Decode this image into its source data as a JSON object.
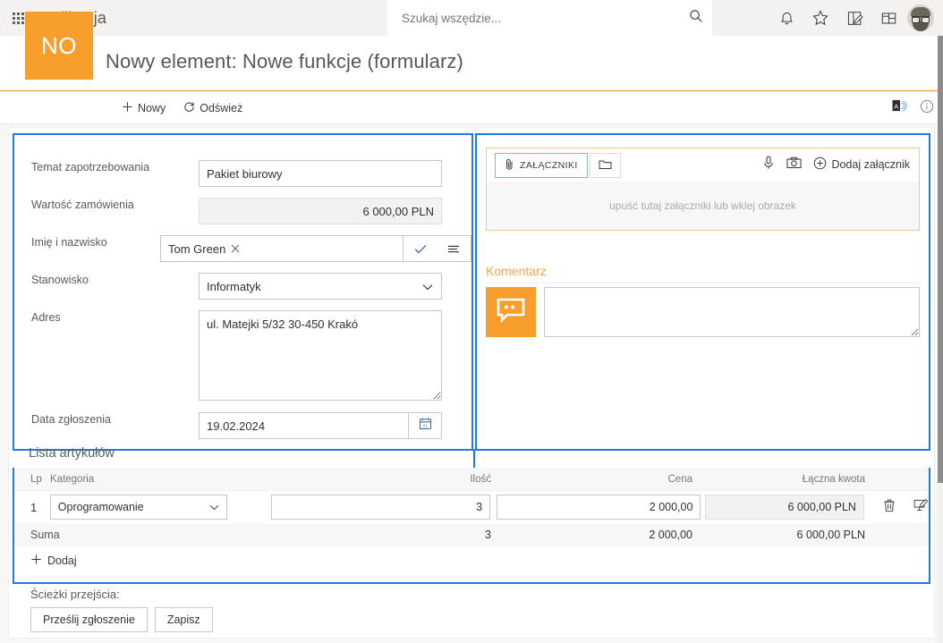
{
  "suitebar": {
    "waffle_label": "app-launcher",
    "app_name": "Aplikacja",
    "search_placeholder": "Szukaj wszędzie...",
    "icons": [
      "bell-icon",
      "star-icon",
      "notebook-edit-icon",
      "board-icon",
      "avatar"
    ]
  },
  "header": {
    "logo_initials": "NO",
    "title": "Nowy element: Nowe funkcje (formularz)",
    "accent_color": "#f79e2c"
  },
  "commandbar": {
    "new_label": "Nowy",
    "refresh_label": "Odśwież",
    "right_icons": [
      "immersive-reader-icon",
      "info-icon"
    ]
  },
  "form": {
    "frame_color": "#1e7ce0",
    "fields": [
      {
        "label": "Temat zapotrzebowania",
        "value": "Pakiet biurowy"
      },
      {
        "label": "Wartość zamówienia",
        "value": "6 000,00 PLN"
      },
      {
        "label": "Imię i nazwisko",
        "value": "Tom Green"
      },
      {
        "label": "Stanowisko",
        "value": "Informatyk"
      },
      {
        "label": "Adres",
        "value": "ul. Matejki 5/32 30-450 Krakó"
      },
      {
        "label": "Data zgłoszenia",
        "value": "19.02.2024"
      }
    ]
  },
  "attachments": {
    "tab_label": "ZAŁĄCZNIKI",
    "folder_icon": "folder-icon",
    "mic_icon": "microphone-icon",
    "camera_icon": "camera-icon",
    "add_label": "Dodaj załącznik",
    "dropzone_text": "upuść tutaj załączniki lub wklej obrazek",
    "border_color": "#f3c98a"
  },
  "comment": {
    "title": "Komentarz",
    "title_color": "#f6a44a",
    "avatar_icon": "comment-bubble-icon",
    "value": "",
    "placeholder": ""
  },
  "article_list": {
    "title": "Lista artykułów",
    "columns": [
      "Lp",
      "Kategoria",
      "Ilość",
      "Cena",
      "Łączna kwota"
    ],
    "rows": [
      {
        "lp": "1",
        "kategoria": "Oprogramowanie",
        "ilosc": "3",
        "cena": "2 000,00",
        "kwota": "6 000,00 PLN",
        "delete_icon": "trash-icon",
        "edit_icon": "edit-screen-icon"
      }
    ],
    "summary": {
      "label": "Suma",
      "ilosc": "3",
      "cena": "2 000,00",
      "kwota": "6 000,00 PLN"
    },
    "add_label": "Dodaj"
  },
  "footer": {
    "paths_label": "Ścieżki przejścia:",
    "buttons": [
      "Prześlij zgłoszenie",
      "Zapisz"
    ]
  }
}
